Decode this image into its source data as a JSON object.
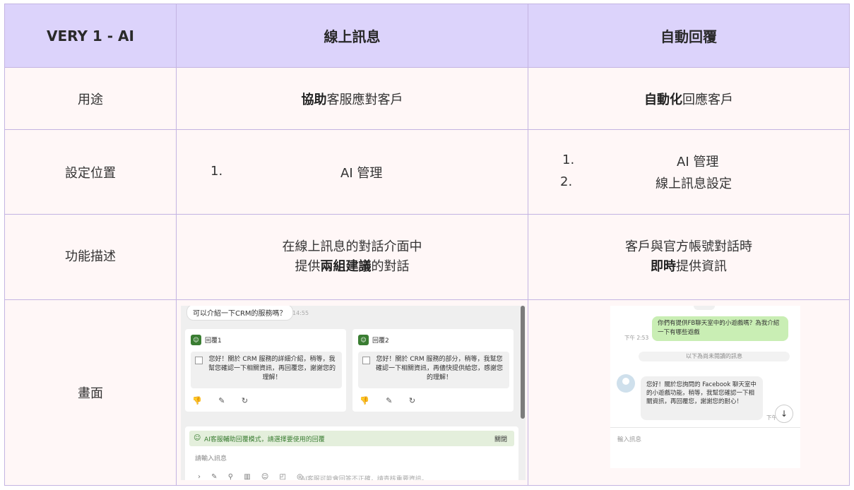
{
  "header": {
    "c0": "VERY 1 - AI",
    "c1": "線上訊息",
    "c2": "自動回覆"
  },
  "rows": {
    "usage": {
      "label": "用途",
      "c1_bold": "協助",
      "c1_rest": "客服應對客戶",
      "c2_bold": "自動化",
      "c2_rest": "回應客戶"
    },
    "setting": {
      "label": "設定位置",
      "c1_num": "1.",
      "c1_item": "AI 管理",
      "c2_num1": "1.",
      "c2_item1": "AI 管理",
      "c2_num2": "2.",
      "c2_item2": "線上訊息設定"
    },
    "desc": {
      "label": "功能描述",
      "c1_line1": "在線上訊息的對話介面中",
      "c1_pre": "提供",
      "c1_bold": "兩組建議",
      "c1_post": "的對話",
      "c2_line1": "客戶與官方帳號對話時",
      "c2_bold": "即時",
      "c2_rest": "提供資訊"
    },
    "screen": {
      "label": "畫面"
    }
  },
  "shot1": {
    "customer_question": "可以介紹一下CRM的服務嗎？",
    "time": "14:55",
    "reply1_title": "回覆1",
    "reply1_text": "您好！關於 CRM 服務的詳細介紹，稍等，我幫您確認一下相關資訊，再回覆您，謝謝您的理解！",
    "reply2_title": "回覆2",
    "reply2_text": "您好！關於 CRM 服務的部分，稍等，我幫您確認一下相關資訊，再儘快提供給您，感謝您的理解！",
    "actions": "👎 ✎ ↻",
    "mode_text": "AI客服輔助回覆模式，請選擇要使用的回覆",
    "close": "關閉",
    "input_placeholder": "請輸入訊息",
    "tools": "› ✎ ⚲ ▥ ☺ ◰ ◎",
    "disclaimer": "AI客服可能會回答不正確，請查核重要資訊。"
  },
  "shot2": {
    "customer_msg": "你們有提供FB聊天室中的小遊戲嗎？為我介紹一下有哪些遊戲",
    "time1": "下午 2:53",
    "unread": "以下為尚未閱讀的訊息",
    "bot_msg": "您好！關於您詢問的 Facebook 聊天室中的小遊戲功能，稍等，我幫您確認一下相關資訊，再回覆您，謝謝您的耐心！",
    "time2": "下午",
    "down_arrow": "↓",
    "input_placeholder": "輸入訊息"
  }
}
